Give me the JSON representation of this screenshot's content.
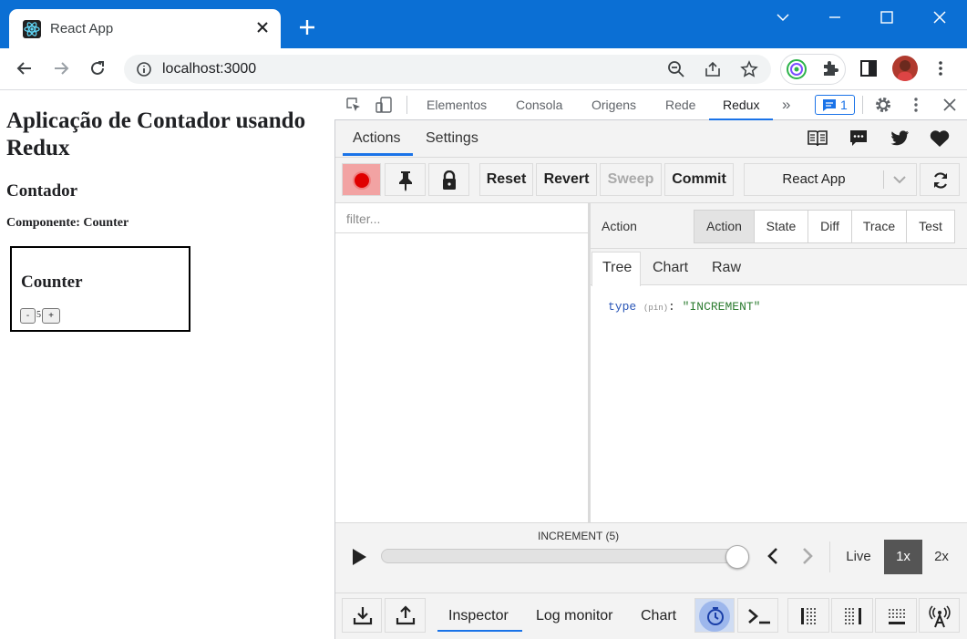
{
  "browser": {
    "tab_title": "React App",
    "url": "localhost:3000"
  },
  "page": {
    "heading": "Aplicação de Contador usando Redux",
    "subheading": "Contador",
    "component_label": "Componente: Counter",
    "counter": {
      "title": "Counter",
      "decrement_label": "-",
      "value": "5",
      "increment_label": "+"
    }
  },
  "devtools": {
    "tabs": [
      "Elementos",
      "Consola",
      "Origens",
      "Rede",
      "Redux"
    ],
    "active_tab": "Redux",
    "messages_count": "1",
    "redux": {
      "tabs": [
        "Actions",
        "Settings"
      ],
      "toolbar": {
        "reset": "Reset",
        "revert": "Revert",
        "sweep": "Sweep",
        "commit": "Commit",
        "instance": "React App"
      },
      "filter_placeholder": "filter...",
      "right_label": "Action",
      "inspector_tabs": [
        "Action",
        "State",
        "Diff",
        "Trace",
        "Test"
      ],
      "view_tabs": [
        "Tree",
        "Chart",
        "Raw"
      ],
      "tree": {
        "key": "type",
        "pin": "(pin)",
        "value": "\"INCREMENT\""
      },
      "slider": {
        "label": "INCREMENT (5)",
        "progress": 1.0,
        "live": "Live",
        "speed_1": "1x",
        "speed_2": "2x"
      },
      "bottom_tabs": [
        "Inspector",
        "Log monitor",
        "Chart"
      ]
    }
  },
  "colors": {
    "chrome_blue": "#0b6fd4",
    "accent": "#1a73e8",
    "record_red": "#e00000"
  }
}
